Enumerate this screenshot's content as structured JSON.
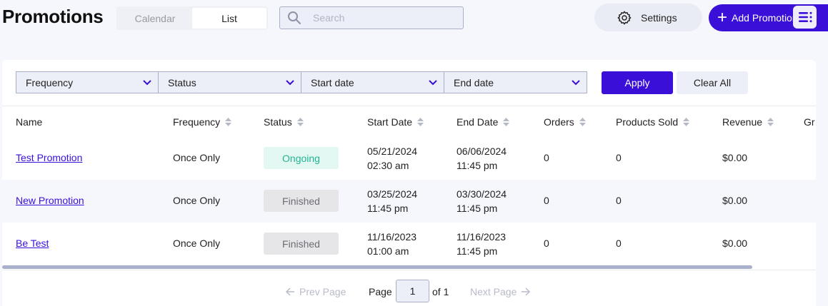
{
  "header": {
    "title": "Promotions",
    "view_tabs": [
      {
        "label": "Calendar",
        "active": false
      },
      {
        "label": "List",
        "active": true
      }
    ],
    "search_placeholder": "Search",
    "settings_label": "Settings",
    "add_label": "Add Promotion"
  },
  "filters": {
    "dropdowns": [
      "Frequency",
      "Status",
      "Start date",
      "End date"
    ],
    "apply_label": "Apply",
    "clear_label": "Clear All"
  },
  "table": {
    "columns": [
      "Name",
      "Frequency",
      "Status",
      "Start Date",
      "End Date",
      "Orders",
      "Products Sold",
      "Revenue",
      "Gr"
    ],
    "rows": [
      {
        "name": "Test Promotion",
        "frequency": "Once Only",
        "status": "Ongoing",
        "start_date": "05/21/2024",
        "start_time": "02:30 am",
        "end_date": "06/06/2024",
        "end_time": "11:45 pm",
        "orders": "0",
        "products_sold": "0",
        "revenue": "$0.00"
      },
      {
        "name": "New Promotion",
        "frequency": "Once Only",
        "status": "Finished",
        "start_date": "03/25/2024",
        "start_time": "11:45 pm",
        "end_date": "03/30/2024",
        "end_time": "11:45 pm",
        "orders": "0",
        "products_sold": "0",
        "revenue": "$0.00"
      },
      {
        "name": "Be Test",
        "frequency": "Once Only",
        "status": "Finished",
        "start_date": "11/16/2023",
        "start_time": "01:00 am",
        "end_date": "11/16/2023",
        "end_time": "11:45 pm",
        "orders": "0",
        "products_sold": "0",
        "revenue": "$0.00"
      }
    ]
  },
  "pagination": {
    "prev_label": "Prev Page",
    "page_label": "Page",
    "current_page": "1",
    "of_label": "of 1",
    "next_label": "Next Page"
  },
  "colors": {
    "accent": "#3a10d9",
    "ongoing_text": "#22b58f",
    "ongoing_bg": "#e3f8f3",
    "finished_bg": "#e6e6e8"
  }
}
